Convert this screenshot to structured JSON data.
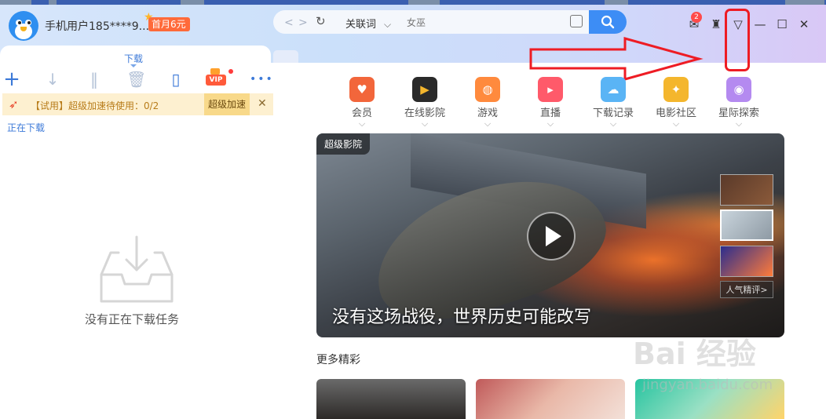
{
  "user": {
    "name": "手机用户185****9...",
    "promo": "首月6元"
  },
  "search": {
    "keyword_mode": "关联词",
    "placeholder": "女巫"
  },
  "header": {
    "notification_count": "2"
  },
  "panel": {
    "tab_label": "下载",
    "notice_text": "【试用】超级加速待使用：0/2",
    "notice_button": "超级加速",
    "section_label": "正在下载",
    "empty_text": "没有正在下载任务",
    "vip_label": "VIP"
  },
  "categories": [
    {
      "label": "会员",
      "icon": "vip-heart-icon",
      "color": "#f2663b"
    },
    {
      "label": "在线影院",
      "icon": "film-icon",
      "color": "#2a2a2a"
    },
    {
      "label": "游戏",
      "icon": "gamepad-icon",
      "color": "#ff8a3d"
    },
    {
      "label": "直播",
      "icon": "tv-icon",
      "color": "#ff5a6a"
    },
    {
      "label": "下载记录",
      "icon": "cloud-icon",
      "color": "#5ab4f5"
    },
    {
      "label": "电影社区",
      "icon": "popcorn-icon",
      "color": "#f4b62d"
    },
    {
      "label": "星际探索",
      "icon": "planet-icon",
      "color": "#b48af0"
    }
  ],
  "banner": {
    "tag": "超级影院",
    "caption": "没有这场战役，世界历史可能改写",
    "popular_label": "人气精评>"
  },
  "more": {
    "title": "更多精彩"
  },
  "watermark": {
    "line1": "Bai 经验",
    "line2": "jingyan.baidu.com"
  }
}
